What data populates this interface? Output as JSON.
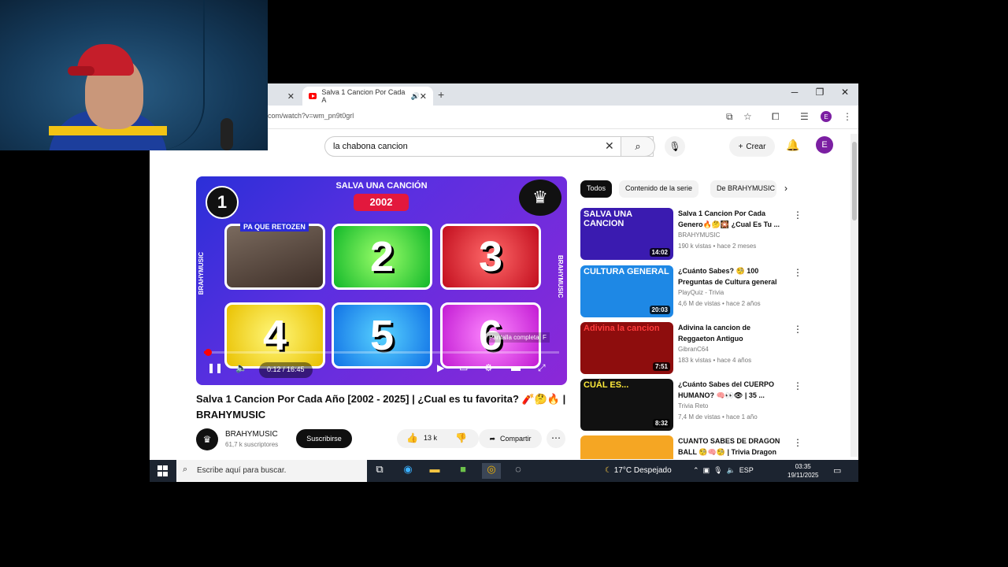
{
  "browser": {
    "tabs": [
      {
        "label": ""
      },
      {
        "label": "Salva 1 Cancion Por Cada A"
      }
    ],
    "url": "com/watch?v=wm_pn9t0grl"
  },
  "youtube": {
    "logo": "Youtube",
    "search_value": "la chabona cancion",
    "create_label": "Crear",
    "avatar_letter": "E"
  },
  "video": {
    "overlay_title": "SALVA UNA CANCIÓN",
    "year": "2002",
    "round": "1",
    "cells": [
      "",
      "2",
      "3",
      "4",
      "5",
      "6"
    ],
    "cell_caption": "PA QUE RETOZEN",
    "side_label": "BRAHYMUSIC",
    "tooltip": "Pantalla completa",
    "tooltip_key": "F",
    "time": "0:12 / 16:45",
    "progress_fraction": 0.012
  },
  "watch": {
    "title": "Salva 1 Cancion Por Cada Año [2002 - 2025] | ¿Cual es tu favorita? 🧨🤔🔥 | BRAHYMUSIC",
    "channel": "BRAHYMUSIC",
    "subscribers": "61,7 k suscriptores",
    "subscribe_label": "Suscribirse",
    "likes": "13 k",
    "share_label": "Compartir"
  },
  "chips": [
    "Todos",
    "Contenido de la serie",
    "De BRAHYMUSIC"
  ],
  "recommendations": [
    {
      "thumb_text": "SALVA UNA CANCION",
      "duration": "14:02",
      "title": "Salva 1 Cancion Por Cada Genero🔥🤔🎇 ¿Cual Es Tu ...",
      "channel": "BRAHYMUSIC",
      "meta": "190 k vistas • hace 2 meses",
      "color": "#3a1bb0"
    },
    {
      "thumb_text": "CULTURA GENERAL",
      "duration": "20:03",
      "title": "¿Cuánto Sabes? 🧐 100 Preguntas de Cultura general ...",
      "channel": "PlayQuiz - Trivia",
      "meta": "4,6 M de vistas • hace 2 años",
      "color": "#1e88e5"
    },
    {
      "thumb_text": "Adivina la cancion",
      "duration": "7:51",
      "title": "Adivina la cancion de Reggaeton Antiguo",
      "channel": "GibranC64",
      "meta": "183 k vistas • hace 4 años",
      "color": "#8e0d0d"
    },
    {
      "thumb_text": "CUÁL ES...",
      "duration": "8:32",
      "title": "¿Cuánto Sabes del CUERPO HUMANO? 🧠👀👁 | 35 ...",
      "channel": "Trivia Reto",
      "meta": "7,4 M de vistas • hace 1 año",
      "color": "#111111"
    },
    {
      "thumb_text": "",
      "duration": "",
      "title": "CUANTO SABES DE DRAGON BALL 🧐🧠🧐 | Trivia Dragon ...",
      "channel": "",
      "meta": "",
      "color": "#f5a623"
    }
  ],
  "taskbar": {
    "search_placeholder": "Escribe aquí para buscar.",
    "weather": "17°C  Despejado",
    "lang": "ESP",
    "time": "03:35",
    "date": "19/11/2025"
  }
}
